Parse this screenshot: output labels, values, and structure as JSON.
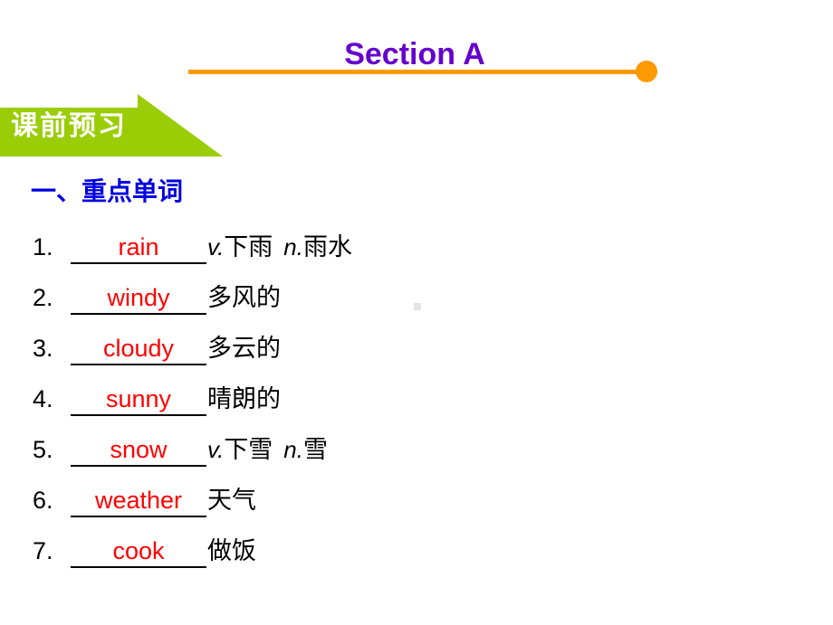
{
  "slide": {
    "title": "Section A",
    "banner_label": "课前预习",
    "section_heading": "一、重点单词"
  },
  "colors": {
    "title_purple": "#6600CC",
    "accent_orange": "#FF9900",
    "banner_green": "#9ACD05",
    "heading_blue": "#0000E0",
    "answer_red": "#FF0000",
    "body_black": "#000000"
  },
  "words": [
    {
      "num": "1.",
      "answer": "rain",
      "gloss_pre": "",
      "pos1": "v.",
      "meaning1": "下雨",
      "pos2": "n.",
      "meaning2": "雨水"
    },
    {
      "num": "2.",
      "answer": "windy",
      "gloss_pre": "",
      "pos1": "",
      "meaning1": "多风的",
      "pos2": "",
      "meaning2": ""
    },
    {
      "num": "3.",
      "answer": "cloudy",
      "gloss_pre": "",
      "pos1": "",
      "meaning1": "多云的",
      "pos2": "",
      "meaning2": ""
    },
    {
      "num": "4.",
      "answer": "sunny",
      "gloss_pre": "",
      "pos1": "",
      "meaning1": "晴朗的",
      "pos2": "",
      "meaning2": ""
    },
    {
      "num": "5.",
      "answer": "snow",
      "gloss_pre": "",
      "pos1": "v.",
      "meaning1": "下雪",
      "pos2": "n.",
      "meaning2": "雪"
    },
    {
      "num": "6.",
      "answer": "weather",
      "gloss_pre": "",
      "pos1": "",
      "meaning1": "天气",
      "pos2": "",
      "meaning2": ""
    },
    {
      "num": "7.",
      "answer": "cook",
      "gloss_pre": "",
      "pos1": "",
      "meaning1": "做饭",
      "pos2": "",
      "meaning2": ""
    }
  ]
}
